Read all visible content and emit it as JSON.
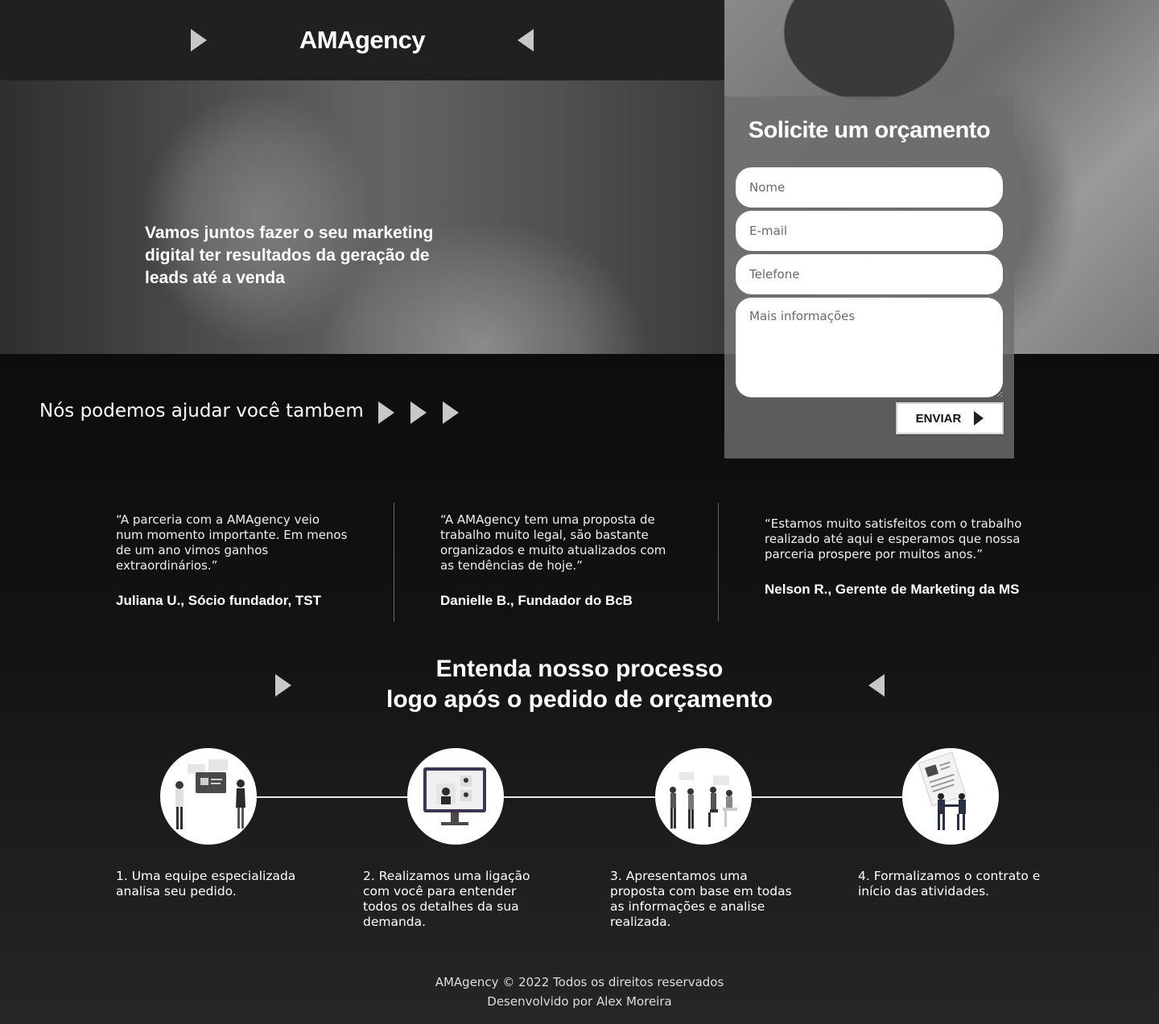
{
  "header": {
    "brand": "AMAgency"
  },
  "hero": {
    "headline": "Vamos juntos fazer o seu marketing digital ter resultados da geração de leads até a venda"
  },
  "form": {
    "title": "Solicite um orçamento",
    "name_placeholder": "Nome",
    "email_placeholder": "E-mail",
    "phone_placeholder": "Telefone",
    "info_placeholder": "Mais informações",
    "submit_label": "ENVIAR"
  },
  "help": {
    "title": "Nós podemos ajudar você tambem"
  },
  "testimonials": [
    {
      "quote": "“A parceria com a AMAgency veio num momento importante. Em menos de um ano vimos ganhos extraordinários.”",
      "author": "Juliana U., Sócio fundador, TST"
    },
    {
      "quote": "“A AMAgency tem uma proposta de trabalho muito legal, são bastante organizados e muito atualizados com as tendências de hoje.”",
      "author": "Danielle B., Fundador do BcB"
    },
    {
      "quote": "“Estamos muito satisfeitos com o trabalho realizado até aqui e esperamos que nossa parceria prospere por muitos anos.”",
      "author": "Nelson R., Gerente de Marketing da MS"
    }
  ],
  "process": {
    "title_line1": "Entenda nosso processo",
    "title_line2": "logo após o pedido de orçamento",
    "steps": [
      {
        "text": "1. Uma equipe especializada analisa seu pedido.",
        "icon": "team-review-illustration"
      },
      {
        "text": "2. Realizamos uma ligação com você para entender todos os detalhes da sua demanda.",
        "icon": "video-call-illustration"
      },
      {
        "text": "3. Apresentamos uma proposta com base em todas as informações e analise realizada.",
        "icon": "presentation-illustration"
      },
      {
        "text": "4. Formalizamos o contrato e início das atividades.",
        "icon": "contract-handshake-illustration"
      }
    ]
  },
  "footer": {
    "copyright": "AMAgency © 2022 Todos os direitos reservados",
    "developer": "Desenvolvido por Alex Moreira"
  },
  "colors": {
    "header_bg": "#202020",
    "form_panel": "#6e6e6e",
    "page_bg": "#0e0e0e",
    "accent_arrow": "#c8c8c8"
  }
}
